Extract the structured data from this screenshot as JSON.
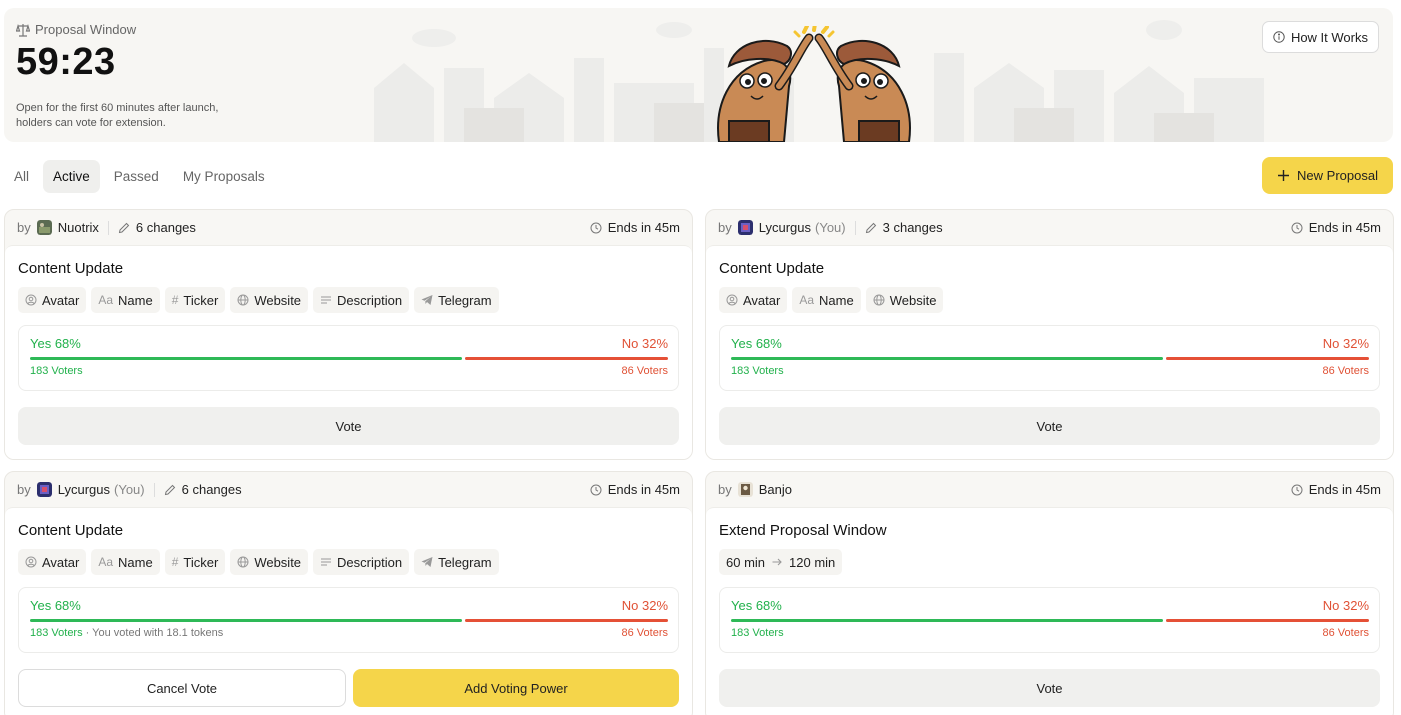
{
  "hero": {
    "label": "Proposal Window",
    "timer": "59:23",
    "description": "Open for the first 60 minutes after launch, holders can vote for extension.",
    "how_it_works": "How It Works"
  },
  "tabs": [
    {
      "label": "All",
      "active": false
    },
    {
      "label": "Active",
      "active": true
    },
    {
      "label": "Passed",
      "active": false
    },
    {
      "label": "My Proposals",
      "active": false
    }
  ],
  "new_proposal": "New Proposal",
  "colors": {
    "accent": "#f5d54a",
    "yes": "#22b14c",
    "no": "#e05236"
  },
  "cards": [
    {
      "by": "by",
      "author": "Nuotrix",
      "you": "",
      "changes": "6 changes",
      "ends": "Ends in 45m",
      "title": "Content Update",
      "chips": [
        {
          "icon": "user-circle-icon",
          "label": "Avatar"
        },
        {
          "icon": "text-aa-icon",
          "label": "Name"
        },
        {
          "icon": "hash-icon",
          "label": "Ticker"
        },
        {
          "icon": "globe-icon",
          "label": "Website"
        },
        {
          "icon": "lines-icon",
          "label": "Description"
        },
        {
          "icon": "telegram-icon",
          "label": "Telegram"
        }
      ],
      "yes_label": "Yes 68%",
      "no_label": "No 32%",
      "yes_fraction": 0.68,
      "yes_voters": "183 Voters",
      "no_voters": "86 Voters",
      "voted_note": "",
      "actions": [
        {
          "label": "Vote",
          "style": "grey"
        }
      ]
    },
    {
      "by": "by",
      "author": "Lycurgus",
      "you": "(You)",
      "changes": "3 changes",
      "ends": "Ends in 45m",
      "title": "Content Update",
      "chips": [
        {
          "icon": "user-circle-icon",
          "label": "Avatar"
        },
        {
          "icon": "text-aa-icon",
          "label": "Name"
        },
        {
          "icon": "globe-icon",
          "label": "Website"
        }
      ],
      "yes_label": "Yes 68%",
      "no_label": "No 32%",
      "yes_fraction": 0.68,
      "yes_voters": "183 Voters",
      "no_voters": "86 Voters",
      "voted_note": "",
      "actions": [
        {
          "label": "Vote",
          "style": "grey"
        }
      ]
    },
    {
      "by": "by",
      "author": "Lycurgus",
      "you": "(You)",
      "changes": "6 changes",
      "ends": "Ends in 45m",
      "title": "Content Update",
      "chips": [
        {
          "icon": "user-circle-icon",
          "label": "Avatar"
        },
        {
          "icon": "text-aa-icon",
          "label": "Name"
        },
        {
          "icon": "hash-icon",
          "label": "Ticker"
        },
        {
          "icon": "globe-icon",
          "label": "Website"
        },
        {
          "icon": "lines-icon",
          "label": "Description"
        },
        {
          "icon": "telegram-icon",
          "label": "Telegram"
        }
      ],
      "yes_label": "Yes 68%",
      "no_label": "No 32%",
      "yes_fraction": 0.68,
      "yes_voters": "183 Voters",
      "no_voters": "86 Voters",
      "voted_note": " · You voted with 18.1 tokens",
      "actions": [
        {
          "label": "Cancel Vote",
          "style": "outline"
        },
        {
          "label": "Add Voting Power",
          "style": "yellow"
        }
      ]
    },
    {
      "by": "by",
      "author": "Banjo",
      "you": "",
      "changes": "",
      "ends": "Ends in 45m",
      "title": "Extend Proposal Window",
      "transition": {
        "from": "60 min",
        "to": "120 min"
      },
      "chips": [],
      "yes_label": "Yes 68%",
      "no_label": "No 32%",
      "yes_fraction": 0.68,
      "yes_voters": "183 Voters",
      "no_voters": "86 Voters",
      "voted_note": "",
      "actions": [
        {
          "label": "Vote",
          "style": "grey"
        }
      ]
    }
  ]
}
